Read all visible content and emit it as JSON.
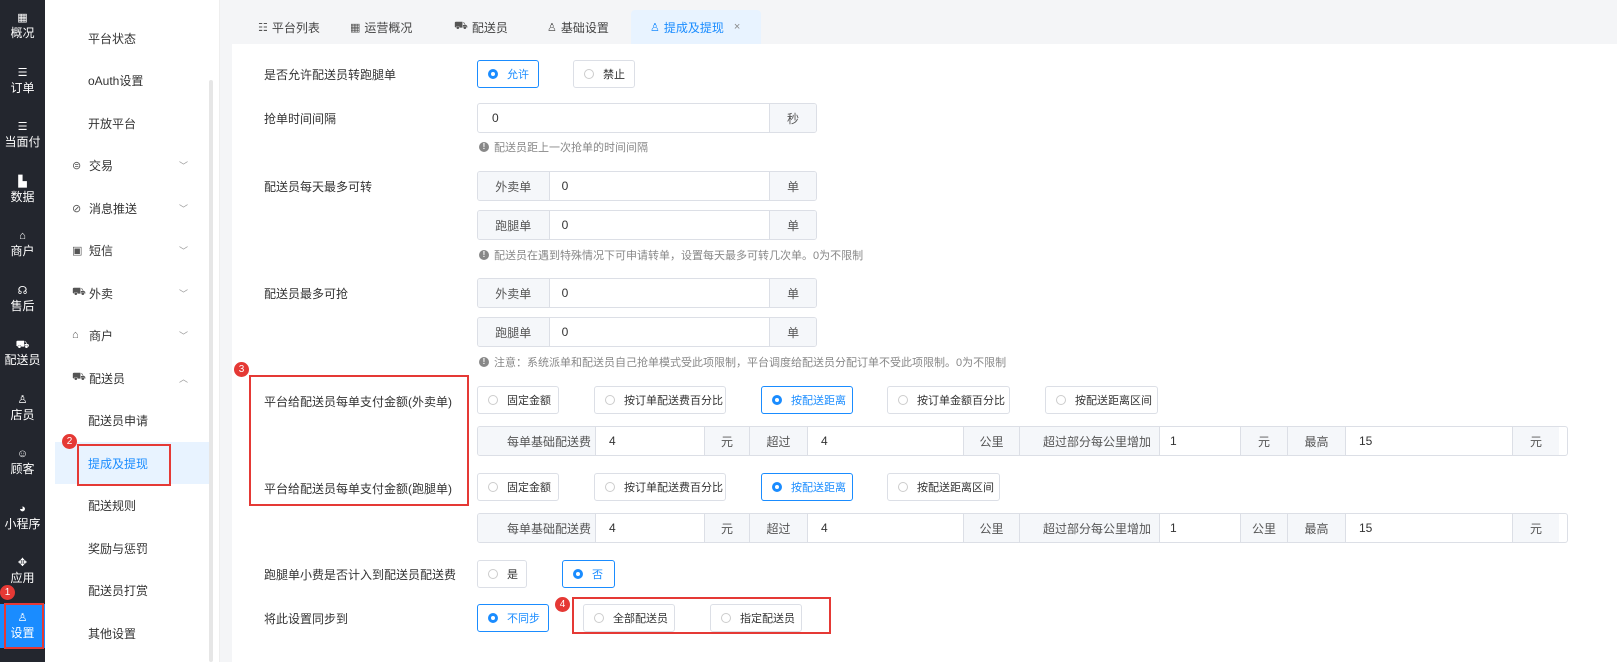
{
  "left_rail": [
    {
      "icon": "grid-icon",
      "glyph": "▦",
      "label": "概况"
    },
    {
      "icon": "list-icon",
      "glyph": "☰",
      "label": "订单"
    },
    {
      "icon": "list-icon",
      "glyph": "☰",
      "label": "当面付"
    },
    {
      "icon": "bar-chart-icon",
      "glyph": "▙",
      "label": "数据"
    },
    {
      "icon": "store-icon",
      "glyph": "⌂",
      "label": "商户"
    },
    {
      "icon": "headset-icon",
      "glyph": "☊",
      "label": "售后"
    },
    {
      "icon": "scooter-icon",
      "glyph": "⛟",
      "label": "配送员"
    },
    {
      "icon": "person-icon",
      "glyph": "♙",
      "label": "店员"
    },
    {
      "icon": "smile-icon",
      "glyph": "☺",
      "label": "顾客"
    },
    {
      "icon": "wechat-icon",
      "glyph": "◕",
      "label": "小程序"
    },
    {
      "icon": "apps-icon",
      "glyph": "✥",
      "label": "应用"
    },
    {
      "icon": "settings-user-icon",
      "glyph": "♙",
      "label": "设置"
    }
  ],
  "sidebar": {
    "items": [
      {
        "label": "平台状态",
        "type": "sub"
      },
      {
        "label": "oAuth设置",
        "type": "sub"
      },
      {
        "label": "开放平台",
        "type": "sub"
      },
      {
        "label": "交易",
        "type": "group",
        "icon": "trade-icon",
        "glyph": "⊜",
        "chev": "﹀"
      },
      {
        "label": "消息推送",
        "type": "group",
        "icon": "push-icon",
        "glyph": "⊘",
        "chev": "﹀"
      },
      {
        "label": "短信",
        "type": "group",
        "icon": "sms-icon",
        "glyph": "▣",
        "chev": "﹀"
      },
      {
        "label": "外卖",
        "type": "group",
        "icon": "takeout-icon",
        "glyph": "⛟",
        "chev": "﹀"
      },
      {
        "label": "商户",
        "type": "group",
        "icon": "store-icon",
        "glyph": "⌂",
        "chev": "﹀"
      },
      {
        "label": "配送员",
        "type": "group",
        "icon": "courier-icon",
        "glyph": "⛟",
        "chev": "︿"
      },
      {
        "label": "配送员申请",
        "type": "sub"
      },
      {
        "label": "提成及提现",
        "type": "sub",
        "active": true
      },
      {
        "label": "配送规则",
        "type": "sub"
      },
      {
        "label": "奖励与惩罚",
        "type": "sub"
      },
      {
        "label": "配送员打赏",
        "type": "sub"
      },
      {
        "label": "其他设置",
        "type": "sub"
      }
    ]
  },
  "tabs": [
    {
      "label": "平台列表",
      "icon": "list-icon",
      "glyph": "☷"
    },
    {
      "label": "运营概况",
      "icon": "grid-icon",
      "glyph": "▦"
    },
    {
      "label": "配送员",
      "icon": "scooter-icon",
      "glyph": "⛟"
    },
    {
      "label": "基础设置",
      "icon": "person-icon",
      "glyph": "♙"
    },
    {
      "label": "提成及提现",
      "icon": "person-icon",
      "glyph": "♙",
      "close": "×"
    }
  ],
  "badges": [
    "1",
    "2",
    "3",
    "4"
  ],
  "form": {
    "transfer": {
      "label": "是否允许配送员转跑腿单",
      "opt1": "允许",
      "opt2": "禁止"
    },
    "interval": {
      "label": "抢单时间间隔",
      "value": "0",
      "unit": "秒",
      "hint": "配送员距上一次抢单的时间间隔"
    },
    "max_transfer": {
      "label": "配送员每天最多可转",
      "takeout_label": "外卖单",
      "takeout_value": "0",
      "errand_label": "跑腿单",
      "errand_value": "0",
      "unit": "单",
      "hint": "配送员在遇到特殊情况下可申请转单，设置每天最多可转几次单。0为不限制"
    },
    "max_grab": {
      "label": "配送员最多可抢",
      "takeout_label": "外卖单",
      "takeout_value": "0",
      "errand_label": "跑腿单",
      "errand_value": "0",
      "unit": "单",
      "hint": "注意：系统派单和配送员自己抢单模式受此项限制，平台调度给配送员分配订单不受此项限制。0为不限制"
    },
    "pay_takeout": {
      "label": "平台给配送员每单支付金额(外卖单)",
      "options": [
        "固定金额",
        "按订单配送费百分比",
        "按配送距离",
        "按订单金额百分比",
        "按配送距离区间"
      ],
      "base_label": "每单基础配送费",
      "base_value": "4",
      "base_unit": "元",
      "over_label": "超过",
      "over_value": "4",
      "over_unit": "公里",
      "extra_label": "超过部分每公里增加",
      "extra_value": "1",
      "extra_unit": "元",
      "max_label": "最高",
      "max_value": "15",
      "max_unit": "元"
    },
    "pay_errand": {
      "label": "平台给配送员每单支付金额(跑腿单)",
      "options": [
        "固定金额",
        "按订单配送费百分比",
        "按配送距离",
        "按配送距离区间"
      ],
      "base_label": "每单基础配送费",
      "base_value": "4",
      "base_unit": "元",
      "over_label": "超过",
      "over_value": "4",
      "over_unit": "公里",
      "extra_label": "超过部分每公里增加",
      "extra_value": "1",
      "extra_unit": "公里",
      "max_label": "最高",
      "max_value": "15",
      "max_unit": "元"
    },
    "tip": {
      "label": "跑腿单小费是否计入到配送员配送费",
      "opt1": "是",
      "opt2": "否"
    },
    "sync": {
      "label": "将此设置同步到",
      "opt1": "不同步",
      "opt2": "全部配送员",
      "opt3": "指定配送员"
    }
  }
}
